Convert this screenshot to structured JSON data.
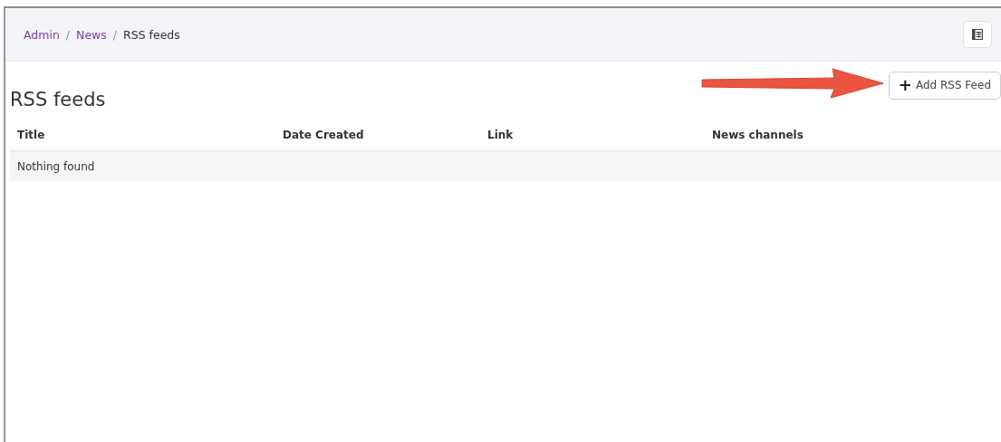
{
  "breadcrumb": [
    {
      "label": "Admin",
      "current": false
    },
    {
      "label": "News",
      "current": false
    },
    {
      "label": "RSS feeds",
      "current": true
    }
  ],
  "breadcrumb_separator": "/",
  "heading": "RSS feeds",
  "add_button": {
    "icon": "+",
    "label": "Add RSS Feed"
  },
  "table": {
    "columns": [
      "Title",
      "Date Created",
      "Link",
      "News channels"
    ],
    "empty_message": "Nothing found"
  }
}
